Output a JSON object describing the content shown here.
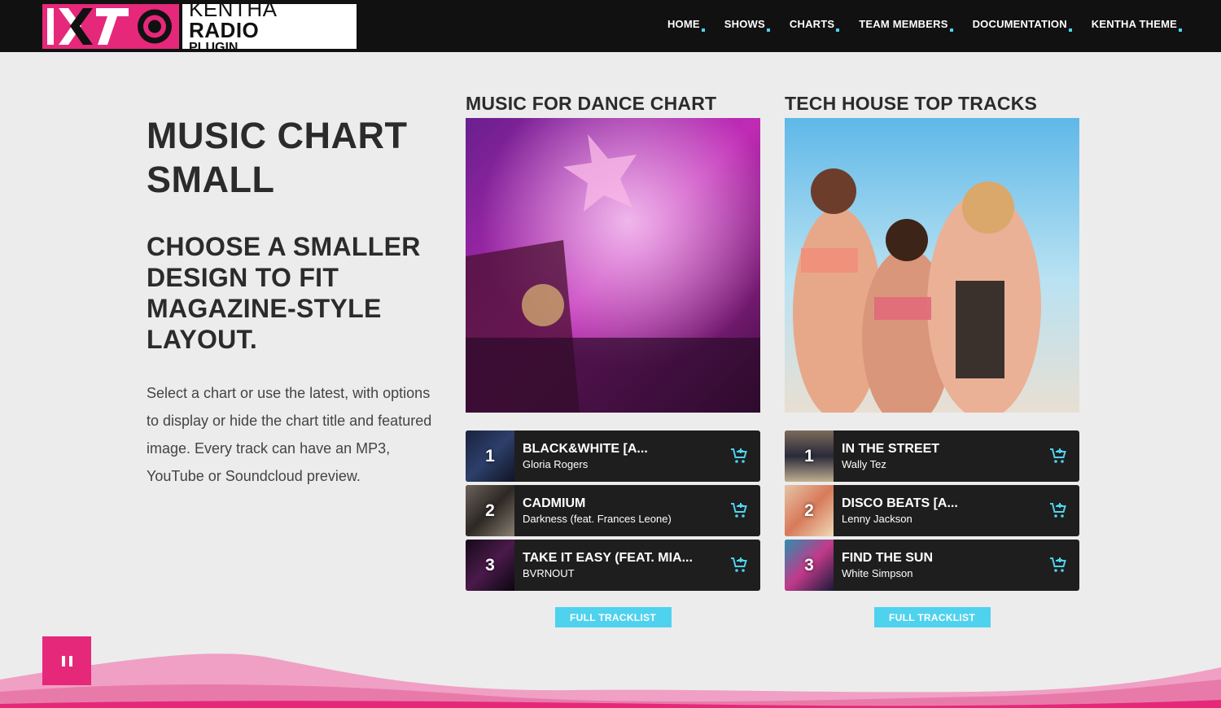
{
  "brand": {
    "mark": "KTO",
    "line1_thin": "KENTHA",
    "line1_bold": "RADIO",
    "line2": "PLUGIN",
    "accent": "#e5287a"
  },
  "nav": [
    {
      "label": "HOME"
    },
    {
      "label": "SHOWS"
    },
    {
      "label": "CHARTS"
    },
    {
      "label": "TEAM MEMBERS"
    },
    {
      "label": "DOCUMENTATION"
    },
    {
      "label": "KENTHA THEME"
    }
  ],
  "intro": {
    "title": "MUSIC CHART SMALL",
    "subtitle": "CHOOSE A SMALLER DESIGN TO FIT MAGAZINE-STYLE LAYOUT.",
    "body": "Select a chart or use the latest, with options to display or hide the chart title and featured image. Every track can have an MP3, YouTube or Soundcloud preview."
  },
  "charts": [
    {
      "title": "MUSIC FOR DANCE CHART",
      "button": "FULL TRACKLIST",
      "tracks": [
        {
          "rank": "1",
          "title": "BLACK&WHITE [A...",
          "artist": "Gloria Rogers",
          "icon": "cart-icon"
        },
        {
          "rank": "2",
          "title": "CADMIUM",
          "artist": "Darkness (feat. Frances Leone)",
          "icon": "cart-icon"
        },
        {
          "rank": "3",
          "title": "TAKE IT EASY (FEAT. MIA...",
          "artist": "BVRNOUT",
          "icon": "cart-icon"
        }
      ]
    },
    {
      "title": "TECH HOUSE TOP TRACKS",
      "button": "FULL TRACKLIST",
      "tracks": [
        {
          "rank": "1",
          "title": "IN THE STREET",
          "artist": "Wally Tez",
          "icon": "cart-icon"
        },
        {
          "rank": "2",
          "title": "DISCO BEATS [A...",
          "artist": "Lenny Jackson",
          "icon": "cart-icon"
        },
        {
          "rank": "3",
          "title": "FIND THE SUN",
          "artist": "White Simpson",
          "icon": "cart-icon"
        }
      ]
    }
  ],
  "player": {
    "icon": "pause-icon"
  },
  "colors": {
    "accent_cyan": "#4fd2ee",
    "accent_pink": "#e5287a",
    "header": "#111111",
    "track_bg": "#1e1e1e"
  }
}
